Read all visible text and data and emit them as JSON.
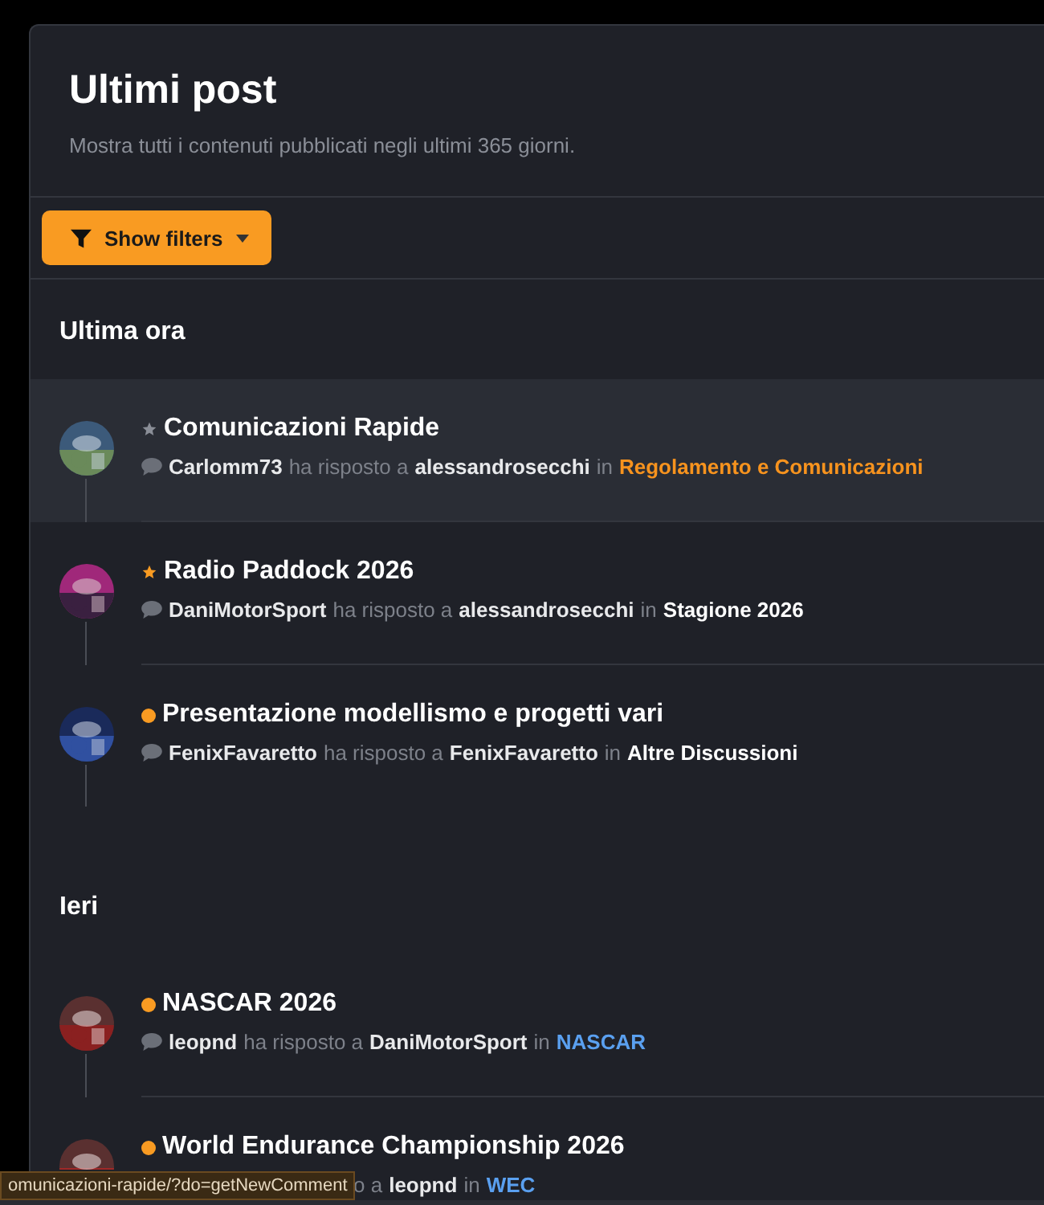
{
  "header": {
    "title": "Ultimi post",
    "subtitle": "Mostra tutti i contenuti pubblicati negli ultimi 365 giorni."
  },
  "filter_button": {
    "label": "Show filters"
  },
  "sections": [
    {
      "heading": "Ultima ora",
      "posts": [
        {
          "title": "Comunicazioni Rapide",
          "highlighted": true,
          "marker": {
            "kind": "star",
            "unread": false
          },
          "replier": "Carlomm73",
          "verb": "ha risposto a",
          "target": "alessandrosecchi",
          "in": "in",
          "forum": "Regolamento e Comunicazioni",
          "color": "#f7931e"
        },
        {
          "title": "Radio Paddock 2026",
          "highlighted": false,
          "marker": {
            "kind": "star",
            "unread": true
          },
          "replier": "DaniMotorSport",
          "verb": "ha risposto a",
          "target": "alessandrosecchi",
          "in": "in",
          "forum": "Stagione 2026",
          "color": "#ffffff"
        },
        {
          "title": "Presentazione modellismo e progetti vari",
          "highlighted": false,
          "marker": {
            "kind": "dot",
            "unread": true
          },
          "replier": "FenixFavaretto",
          "verb": "ha risposto a",
          "target": "FenixFavaretto",
          "in": "in",
          "forum": "Altre Discussioni",
          "color": "#ffffff"
        }
      ]
    },
    {
      "heading": "Ieri",
      "posts": [
        {
          "title": "NASCAR 2026",
          "highlighted": false,
          "marker": {
            "kind": "dot",
            "unread": true
          },
          "replier": "leopnd",
          "verb": "ha risposto a",
          "target": "DaniMotorSport",
          "in": "in",
          "forum": "NASCAR",
          "color": "#5aa0f0"
        },
        {
          "title": "World Endurance Championship 2026",
          "highlighted": false,
          "marker": {
            "kind": "dot",
            "unread": true
          },
          "verb": "o a",
          "target": "leopnd",
          "in": "in",
          "forum": "WEC",
          "color": "#5aa0f0"
        }
      ]
    }
  ],
  "status_tooltip": "omunicazioni-rapide/?do=getNewComment"
}
